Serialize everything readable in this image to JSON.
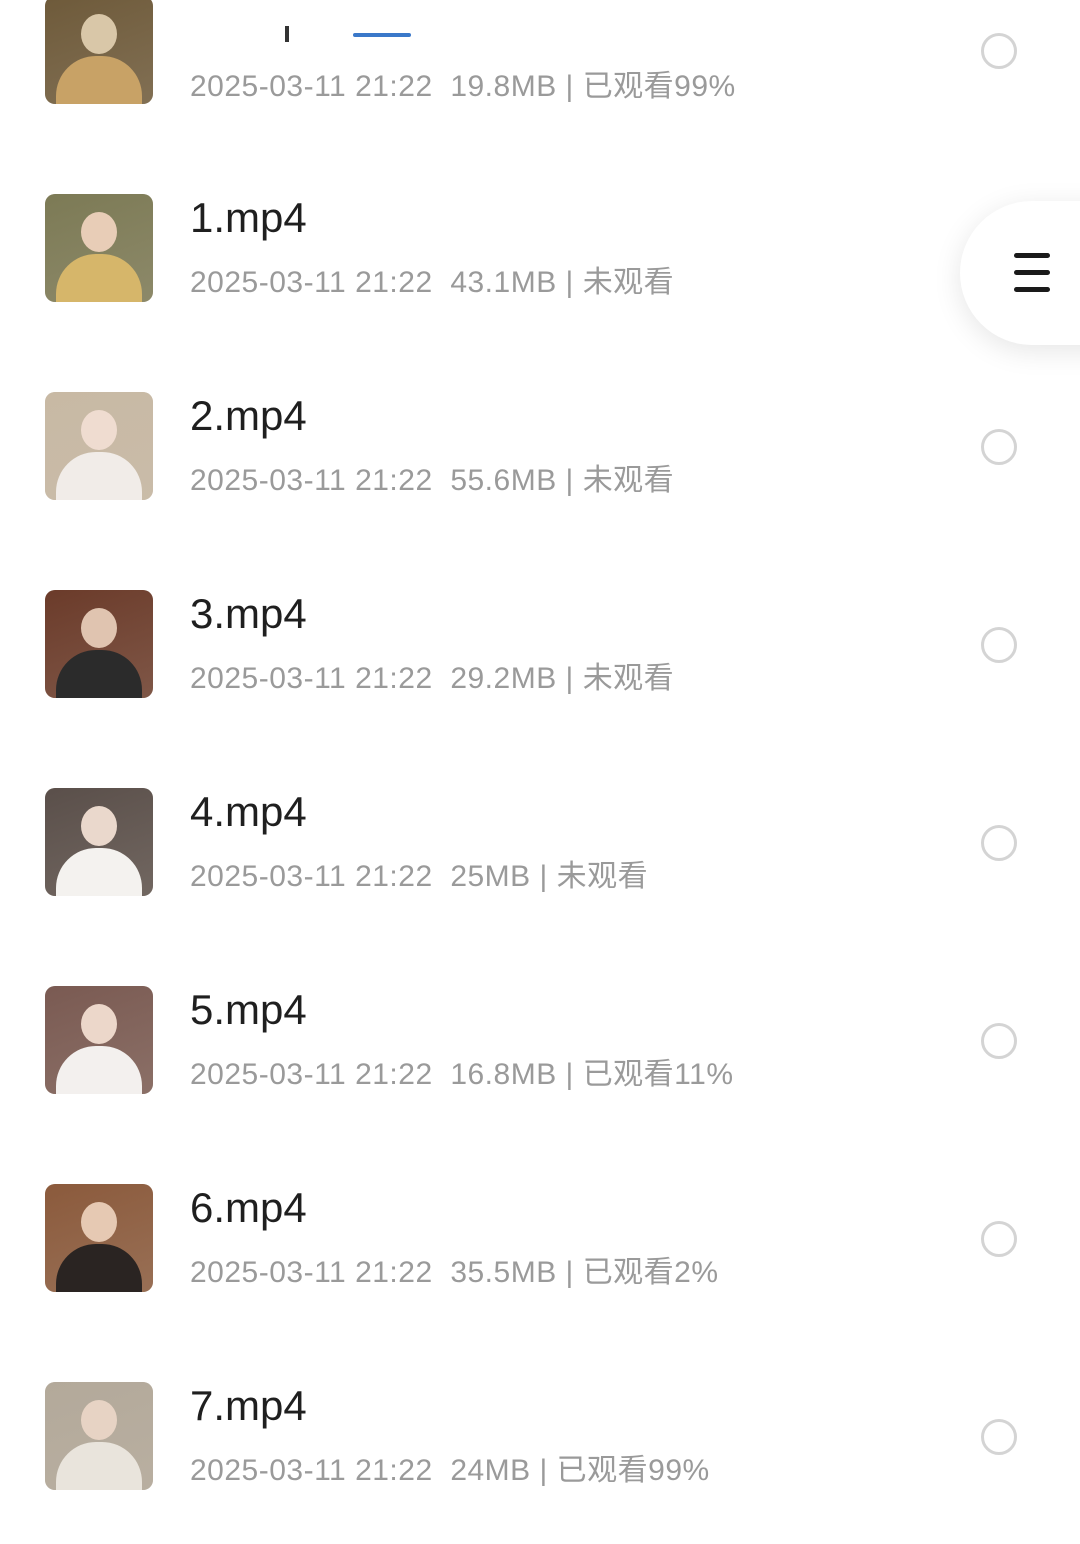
{
  "files": [
    {
      "title": "",
      "date": "2025-03-11 21:22",
      "size": "19.8MB",
      "status": "已观看99%",
      "thumb_colors": [
        "#6e5a3a",
        "#d9c7a8",
        "#c8a266"
      ]
    },
    {
      "title": "1.mp4",
      "date": "2025-03-11 21:22",
      "size": "43.1MB",
      "status": "未观看",
      "thumb_colors": [
        "#7c7a55",
        "#e8cdb7",
        "#d6b66a"
      ]
    },
    {
      "title": "2.mp4",
      "date": "2025-03-11 21:22",
      "size": "55.6MB",
      "status": "未观看",
      "thumb_colors": [
        "#c8b9a4",
        "#efdcd0",
        "#f1ece8"
      ]
    },
    {
      "title": "3.mp4",
      "date": "2025-03-11 21:22",
      "size": "29.2MB",
      "status": "未观看",
      "thumb_colors": [
        "#6b3b2a",
        "#e0c4b0",
        "#2b2b2b"
      ]
    },
    {
      "title": "4.mp4",
      "date": "2025-03-11 21:22",
      "size": "25MB",
      "status": "未观看",
      "thumb_colors": [
        "#5a4f4a",
        "#ead8cc",
        "#f4f2ef"
      ]
    },
    {
      "title": "5.mp4",
      "date": "2025-03-11 21:22",
      "size": "16.8MB",
      "status": "已观看11%",
      "thumb_colors": [
        "#7a5a52",
        "#ecd7ca",
        "#f3f0ee"
      ]
    },
    {
      "title": "6.mp4",
      "date": "2025-03-11 21:22",
      "size": "35.5MB",
      "status": "已观看2%",
      "thumb_colors": [
        "#8b5a3c",
        "#e6c9b3",
        "#2a2422"
      ]
    },
    {
      "title": "7.mp4",
      "date": "2025-03-11 21:22",
      "size": "24MB",
      "status": "已观看99%",
      "thumb_colors": [
        "#b3a99a",
        "#e7d3c4",
        "#e9e4dc"
      ]
    }
  ],
  "floating_menu": {
    "icon": "menu-icon"
  },
  "colors": {
    "title": "#1f1f1f",
    "meta": "#9a9a9a",
    "radio_border": "#d4d4d4",
    "accent": "#3a78c9"
  }
}
